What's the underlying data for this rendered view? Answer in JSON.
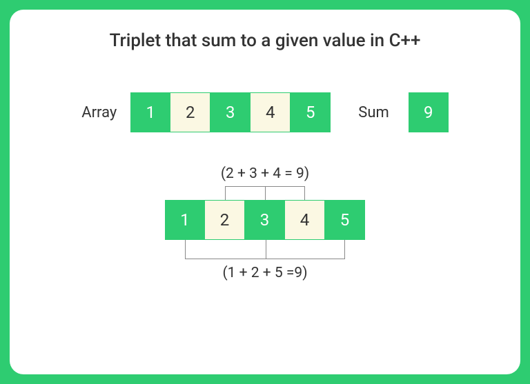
{
  "title": "Triplet that sum to a given value in C++",
  "labels": {
    "array": "Array",
    "sum": "Sum"
  },
  "array": [
    "1",
    "2",
    "3",
    "4",
    "5"
  ],
  "sum_value": "9",
  "triplet_top": {
    "expr": "(2 + 3 + 4 = 9)",
    "indices": [
      1,
      2,
      3
    ]
  },
  "triplet_bottom": {
    "expr": "(1 + 2 + 5 =9)",
    "indices": [
      0,
      1,
      4
    ]
  },
  "colors": {
    "accent": "#2ecc71",
    "light": "#fbf8e3"
  }
}
